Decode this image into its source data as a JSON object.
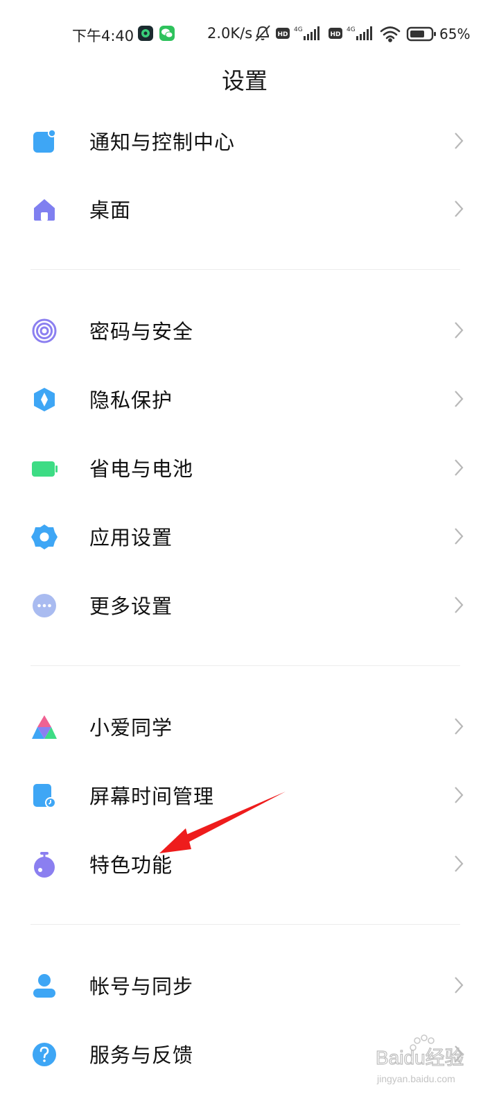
{
  "status_bar": {
    "time": "下午4:40",
    "net_speed": "2.0K/s",
    "battery": "65%",
    "net_badges": [
      "HD",
      "4G",
      "HD",
      "4G"
    ],
    "icons": [
      "app-notification-icon",
      "wechat-icon",
      "mute-bell-icon",
      "hd-icon",
      "signal-4g-icon",
      "hd-icon",
      "signal-4g-icon",
      "wifi-icon",
      "battery-icon"
    ]
  },
  "header": {
    "title": "设置"
  },
  "groups": [
    {
      "items": [
        {
          "label": "通知与控制中心",
          "icon": "notification-icon"
        },
        {
          "label": "桌面",
          "icon": "home-icon"
        }
      ]
    },
    {
      "items": [
        {
          "label": "密码与安全",
          "icon": "fingerprint-icon"
        },
        {
          "label": "隐私保护",
          "icon": "privacy-shield-icon"
        },
        {
          "label": "省电与电池",
          "icon": "battery-icon"
        },
        {
          "label": "应用设置",
          "icon": "gear-icon"
        },
        {
          "label": "更多设置",
          "icon": "more-dots-icon"
        }
      ]
    },
    {
      "items": [
        {
          "label": "小爱同学",
          "icon": "assistant-icon"
        },
        {
          "label": "屏幕时间管理",
          "icon": "screen-time-icon"
        },
        {
          "label": "特色功能",
          "icon": "stopwatch-icon"
        }
      ]
    },
    {
      "items": [
        {
          "label": "帐号与同步",
          "icon": "account-icon"
        },
        {
          "label": "服务与反馈",
          "icon": "help-icon"
        }
      ]
    }
  ],
  "watermark": {
    "brand": "Baidu经验",
    "url": "jingyan.baidu.com"
  },
  "colors": {
    "accent_blue": "#3ea6f5",
    "purple": "#7f7ff0",
    "green": "#3ddc84",
    "arrow_red": "#ee1c1c"
  }
}
